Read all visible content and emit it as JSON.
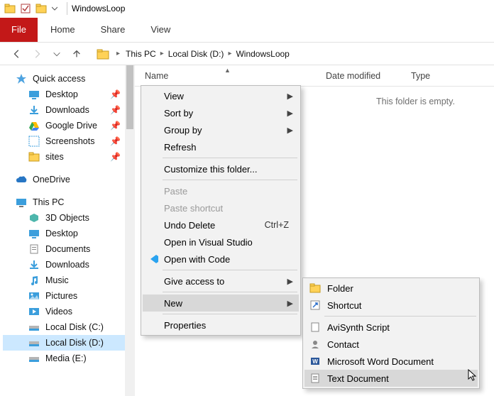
{
  "titlebar": {
    "title": "WindowsLoop"
  },
  "ribbon": {
    "file": "File",
    "home": "Home",
    "share": "Share",
    "view": "View"
  },
  "breadcrumbs": {
    "root": "This PC",
    "drive": "Local Disk (D:)",
    "folder": "WindowsLoop"
  },
  "columns": {
    "name": "Name",
    "date": "Date modified",
    "type": "Type"
  },
  "empty_message": "This folder is empty.",
  "sidebar": {
    "quick_access": "Quick access",
    "desktop": "Desktop",
    "downloads": "Downloads",
    "google_drive": "Google Drive",
    "screenshots": "Screenshots",
    "sites": "sites",
    "onedrive": "OneDrive",
    "this_pc": "This PC",
    "objects3d": "3D Objects",
    "desktop2": "Desktop",
    "documents": "Documents",
    "downloads2": "Downloads",
    "music": "Music",
    "pictures": "Pictures",
    "videos": "Videos",
    "diskc": "Local Disk (C:)",
    "diskd": "Local Disk (D:)",
    "media_e": "Media (E:)"
  },
  "ctx": {
    "view": "View",
    "sort_by": "Sort by",
    "group_by": "Group by",
    "refresh": "Refresh",
    "customize": "Customize this folder...",
    "paste": "Paste",
    "paste_shortcut": "Paste shortcut",
    "undo_delete": "Undo Delete",
    "undo_shortcut": "Ctrl+Z",
    "open_vs": "Open in Visual Studio",
    "open_code": "Open with Code",
    "give_access": "Give access to",
    "new": "New",
    "properties": "Properties"
  },
  "ctx_new": {
    "folder": "Folder",
    "shortcut": "Shortcut",
    "avisynth": "AviSynth Script",
    "contact": "Contact",
    "word": "Microsoft Word Document",
    "text": "Text Document"
  }
}
